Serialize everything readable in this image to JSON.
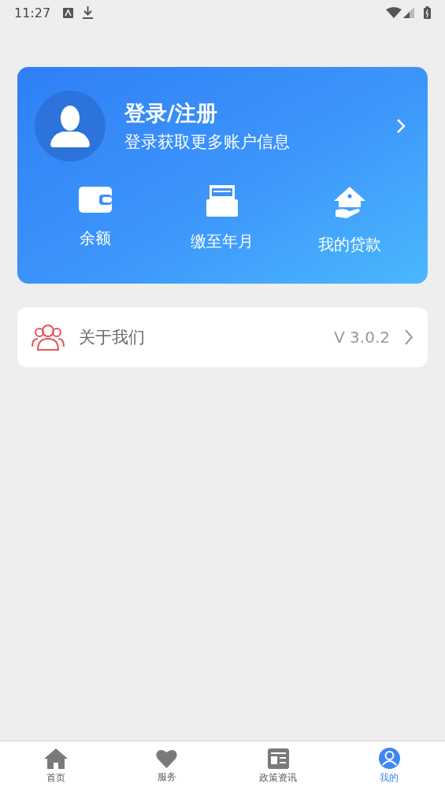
{
  "status_bar": {
    "time": "11:27"
  },
  "profile_card": {
    "title": "登录/注册",
    "subtitle": "登录获取更多账户信息",
    "shortcuts": [
      {
        "kind": "wallet",
        "label": "余额"
      },
      {
        "kind": "document",
        "label": "缴至年月"
      },
      {
        "kind": "house",
        "label": "我的贷款"
      }
    ]
  },
  "menu": [
    {
      "kind": "people",
      "label": "关于我们",
      "value": "V 3.0.2"
    }
  ],
  "tab_bar": [
    {
      "kind": "home",
      "label": "首页",
      "selected": false
    },
    {
      "kind": "heart",
      "label": "服务",
      "selected": false
    },
    {
      "kind": "news",
      "label": "政策资讯",
      "selected": false
    },
    {
      "kind": "user",
      "label": "我的",
      "selected": true
    }
  ]
}
